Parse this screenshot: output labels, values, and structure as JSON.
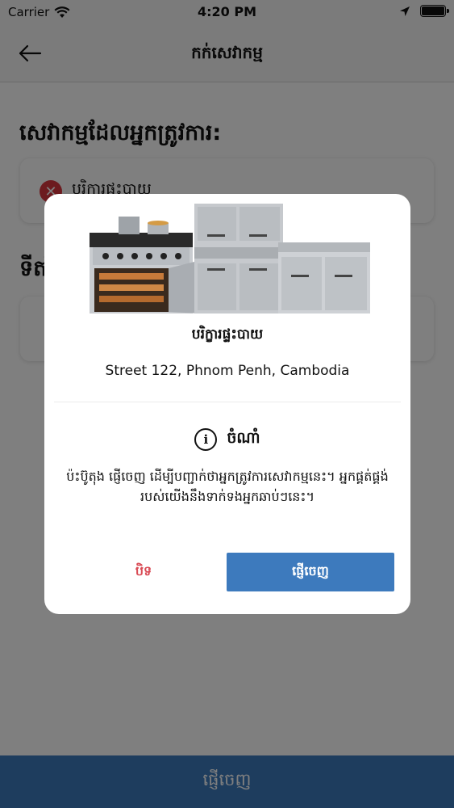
{
  "status_bar": {
    "carrier": "Carrier",
    "time": "4:20 PM"
  },
  "nav": {
    "title": "កក់សេវាកម្ម"
  },
  "page": {
    "section1_title": "សេវាកម្មដែលអ្នកត្រូវការ:",
    "selected_service": "បរិក្ខារផ្ទះបាយ",
    "section2_title": "ទីតាំង"
  },
  "bottom_bar": {
    "label": "ផ្ញើចេញ"
  },
  "modal": {
    "service_title": "បរិក្ខារផ្ទះបាយ",
    "address": "Street 122, Phnom Penh, Cambodia",
    "note_title": "ចំណាំ",
    "note_body": "ប៉ះប៊ូតុង ផ្ញើចេញ ដើម្បីបញ្ជាក់ថាអ្នកត្រូវការសេវាកម្មនេះ។ អ្នកផ្គត់ផ្គង់របស់យើងនឹងទាក់ទងអ្នកឆាប់ៗនេះ។",
    "close_label": "បិទ",
    "submit_label": "ផ្ញើចេញ"
  },
  "colors": {
    "accent": "#3d7abd",
    "danger": "#d9363e"
  },
  "icons": [
    "wifi-icon",
    "location-arrow-icon",
    "battery-icon",
    "back-arrow-icon",
    "remove-icon",
    "info-icon"
  ]
}
